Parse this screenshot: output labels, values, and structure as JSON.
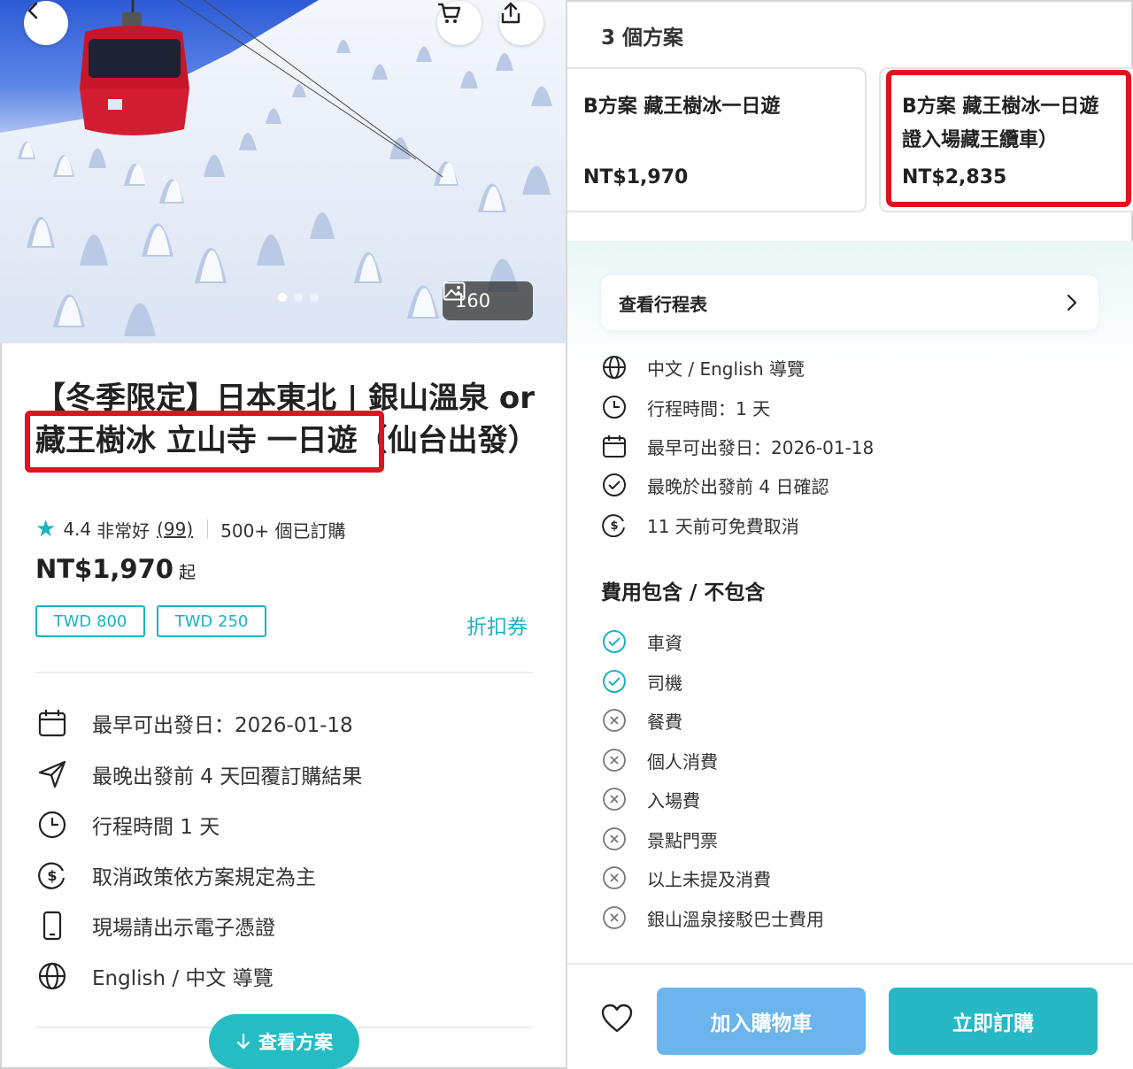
{
  "hero": {
    "photo_count": "160",
    "carousel_active_index": 0,
    "carousel_total": 3
  },
  "product": {
    "title": "【冬季限定】日本東北 | 銀山溫泉 or 藏王樹冰 立山寺 一日遊（仙台出發）",
    "rating": "4.4",
    "rating_label": "非常好",
    "review_count": "(99)",
    "booked": "500+ 個已訂購",
    "price": "NT$1,970",
    "price_suffix": "起",
    "coupons": [
      "TWD 800",
      "TWD 250"
    ],
    "coupon_link": "折扣券"
  },
  "features": [
    {
      "icon": "calendar-icon",
      "text": "最早可出發日：2026-01-18"
    },
    {
      "icon": "send-icon",
      "text": "最晚出發前 4 天回覆訂購結果"
    },
    {
      "icon": "clock-icon",
      "text": "行程時間 1 天"
    },
    {
      "icon": "dollar-cancel-icon",
      "text": "取消政策依方案規定為主"
    },
    {
      "icon": "phone-icon",
      "text": "現場請出示電子憑證"
    },
    {
      "icon": "globe-icon",
      "text": "English / 中文 導覽"
    }
  ],
  "view_plans_label": "查看方案",
  "plans": {
    "count_label": "3 個方案",
    "items": [
      {
        "name": "B方案 藏王樹冰一日遊",
        "price": "NT$1,970"
      },
      {
        "name_line1": "B方案 藏王樹冰一日遊",
        "name_line2": "證入場藏王纜車）",
        "price": "NT$2,835"
      }
    ]
  },
  "itinerary_label": "查看行程表",
  "details": [
    {
      "icon": "globe-icon",
      "text": "中文 / English 導覽"
    },
    {
      "icon": "clock-icon",
      "text": "行程時間：1 天"
    },
    {
      "icon": "calendar-icon",
      "text": "最早可出發日：2026-01-18"
    },
    {
      "icon": "check-circle-icon",
      "text": "最晚於出發前 4 日確認"
    },
    {
      "icon": "dollar-cancel-icon",
      "text": "11 天前可免費取消"
    }
  ],
  "fees": {
    "title": "費用包含 / 不包含",
    "items": [
      {
        "included": true,
        "text": "車資"
      },
      {
        "included": true,
        "text": "司機"
      },
      {
        "included": false,
        "text": "餐費"
      },
      {
        "included": false,
        "text": "個人消費"
      },
      {
        "included": false,
        "text": "入場費"
      },
      {
        "included": false,
        "text": "景點門票"
      },
      {
        "included": false,
        "text": "以上未提及消費"
      },
      {
        "included": false,
        "text": "銀山溫泉接駁巴士費用"
      }
    ]
  },
  "actions": {
    "add_to_cart": "加入購物車",
    "book_now": "立即訂購"
  },
  "colors": {
    "accent": "#19b4c2",
    "highlight": "#e3101d",
    "cart_button": "#6cb5ec",
    "buy_button": "#26b8c4"
  }
}
